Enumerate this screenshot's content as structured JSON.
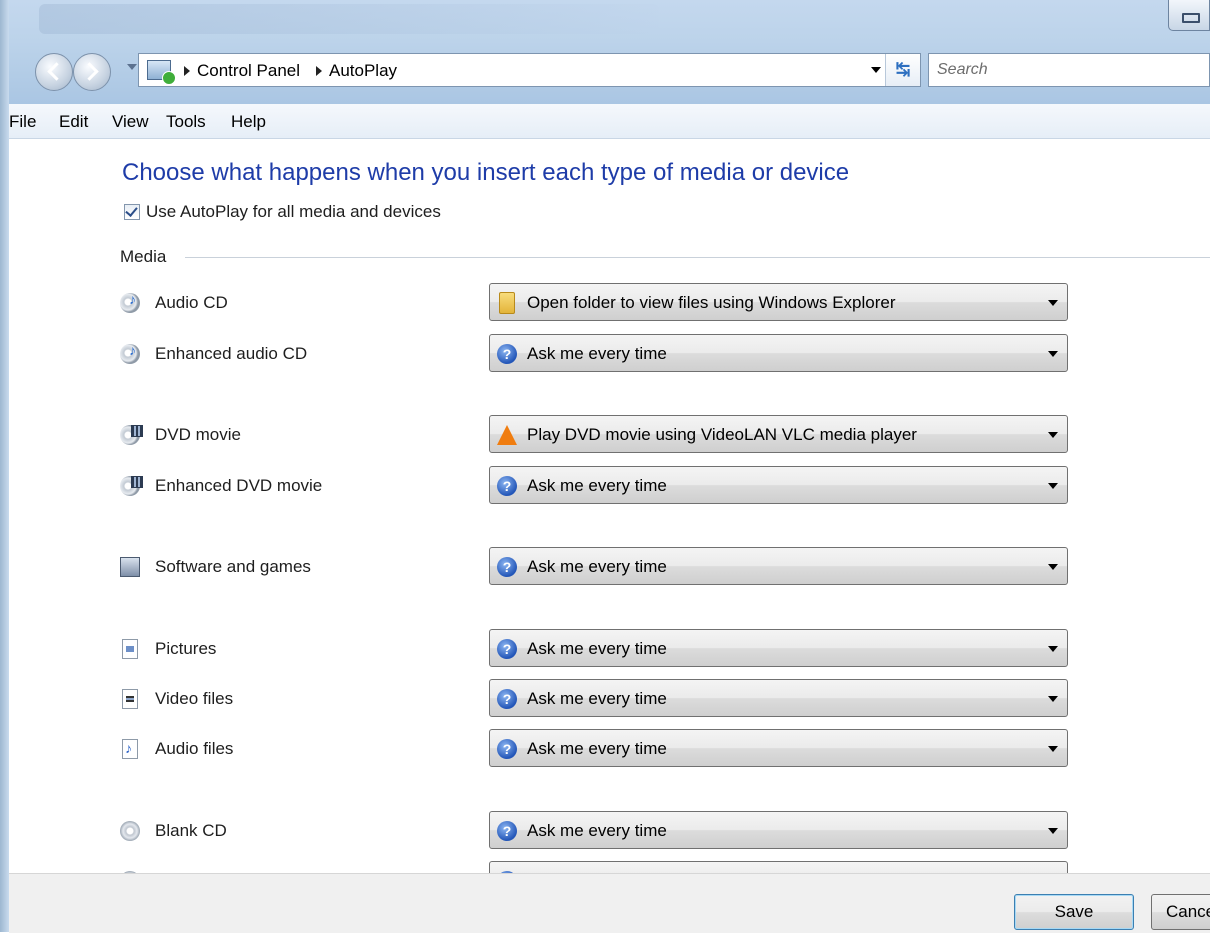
{
  "window": {
    "restore_icon": "restore-icon"
  },
  "address": {
    "crumbs": [
      "Control Panel",
      "AutoPlay"
    ],
    "search_placeholder": "Search"
  },
  "menu": [
    "File",
    "Edit",
    "View",
    "Tools",
    "Help"
  ],
  "main": {
    "heading": "Choose what happens when you insert each type of media or device",
    "use_autoplay_label": "Use AutoPlay for all media and devices",
    "use_autoplay_checked": true,
    "section_label": "Media",
    "rows": [
      {
        "label": "Audio CD",
        "icon": "audio-cd-icon",
        "action": "Open folder to view files using Windows Explorer",
        "action_icon": "folder-icon"
      },
      {
        "label": "Enhanced audio CD",
        "icon": "enhanced-audio-cd-icon",
        "action": "Ask me every time",
        "action_icon": "help-icon"
      },
      {
        "label": "DVD movie",
        "icon": "dvd-movie-icon",
        "action": "Play DVD movie using VideoLAN VLC media player",
        "action_icon": "vlc-icon"
      },
      {
        "label": "Enhanced DVD movie",
        "icon": "enhanced-dvd-movie-icon",
        "action": "Ask me every time",
        "action_icon": "help-icon"
      },
      {
        "label": "Software and games",
        "icon": "software-games-icon",
        "action": "Ask me every time",
        "action_icon": "help-icon"
      },
      {
        "label": "Pictures",
        "icon": "pictures-icon",
        "action": "Ask me every time",
        "action_icon": "help-icon"
      },
      {
        "label": "Video files",
        "icon": "video-files-icon",
        "action": "Ask me every time",
        "action_icon": "help-icon"
      },
      {
        "label": "Audio files",
        "icon": "audio-files-icon",
        "action": "Ask me every time",
        "action_icon": "help-icon"
      },
      {
        "label": "Blank CD",
        "icon": "blank-cd-icon",
        "action": "Ask me every time",
        "action_icon": "help-icon"
      }
    ]
  },
  "buttons": {
    "save": "Save",
    "cancel": "Cancel"
  }
}
